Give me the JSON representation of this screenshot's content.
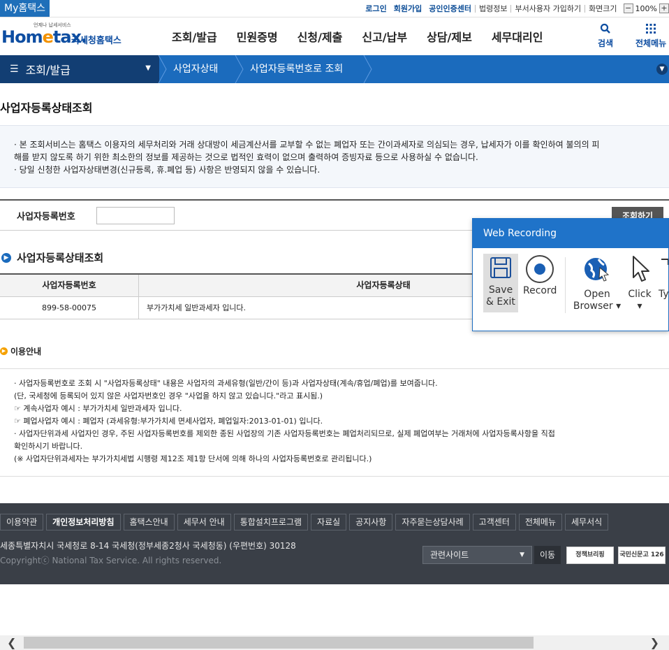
{
  "topbar": {
    "my_hometax": "My홈택스",
    "links": [
      "로그인",
      "회원가입",
      "공인인증센터",
      "법령정보",
      "부서사용자 가입하기",
      "화면크기"
    ],
    "zoom": "100%",
    "zoom_minus": "−",
    "zoom_plus": "+"
  },
  "header": {
    "logo_small": "언제나 납세서비스",
    "logo_home_1": "Hom",
    "logo_home_e": "e",
    "logo_home_2": "tax.",
    "logo_kr": "국세청홈택스",
    "gnb": [
      "조회/발급",
      "민원증명",
      "신청/제출",
      "신고/납부",
      "상담/제보",
      "세무대리인"
    ],
    "search_label": "검색",
    "allmenu_label": "전체메뉴"
  },
  "navbar": {
    "current": "조회/발급",
    "crumb1": "사업자상태",
    "crumb2": "사업자등록번호로 조회"
  },
  "page": {
    "title": "사업자등록상태조회",
    "notice": [
      "· 본 조회서비스는 홈택스 이용자의 세무처리와 거래 상대방이 세금계산서를 교부할 수 없는 폐업자 또는 간이과세자로 의심되는 경우, 납세자가 이를 확인하여 불의의 피",
      "  해를 받지 않도록 하기 위한 최소한의 정보를 제공하는 것으로 법적인 효력이 없으며 출력하여 증빙자료 등으로 사용하실 수 없습니다.",
      "· 당일 신청한 사업자상태변경(신규등록, 휴.폐업 등) 사항은 반영되지 않을 수 있습니다."
    ],
    "search_label": "사업자등록번호",
    "search_value": "",
    "search_button": "조회하기",
    "section_title": "사업자등록상태조회",
    "table": {
      "headers": [
        "사업자등록번호",
        "사업자등록상태"
      ],
      "rows": [
        [
          "899-58-00075",
          "부가가치세 일반과세자 입니다."
        ]
      ]
    },
    "guide_title": "이용안내",
    "guide": [
      "· 사업자등록번호로 조회 시 \"사업자등록상태\" 내용은 사업자의 과세유형(일반/간이 등)과 사업자상태(계속/휴업/폐업)를 보여줍니다.",
      "  (단, 국세청에 등록되어 있지 않은 사업자번호인 경우 \"사업을 하지 않고 있습니다.\"라고 표시됨.)",
      "    ☞ 계속사업자 예시 : 부가가치세 일반과세자 입니다.",
      "    ☞ 폐업사업자 예시 : 폐업자 (과세유형:부가가치세 면세사업자, 폐업일자:2013-01-01) 입니다.",
      "· 사업자단위과세 사업자인 경우, 주된 사업자등록번호를 제외한 종된 사업장의 기존 사업자등록번호는 폐업처리되므로, 실제 폐업여부는 거래처에 사업자등록사항을 직접",
      "  확인하시기 바랍니다.",
      "  (※ 사업자단위과세자는 부가가치세법 시행령 제12조 제1항 단서에 의해 하나의 사업자등록번호로 관리됩니다.)"
    ]
  },
  "footer": {
    "menu": [
      "이용약관",
      "개인정보처리방침",
      "홈택스안내",
      "세무서 안내",
      "통합설치프로그램",
      "자료실",
      "공지사항",
      "자주묻는상담사례",
      "고객센터",
      "전체메뉴",
      "세무서식"
    ],
    "address": "세종특별자치시 국세청로 8-14 국세청(정부세종2청사 국세청동) (우편번호) 30128",
    "copyright": "Copyrightⓒ National Tax Service. All rights reserved.",
    "related_sites": "관련사이트",
    "go": "이동",
    "badge1": "정책브리핑",
    "badge2": "국민신문고 126"
  },
  "recorder": {
    "title": "Web Recording",
    "save1": "Save",
    "save2": "& Exit",
    "record": "Record",
    "open1": "Open",
    "open2": "Browser",
    "click": "Click",
    "type": "Ty"
  }
}
